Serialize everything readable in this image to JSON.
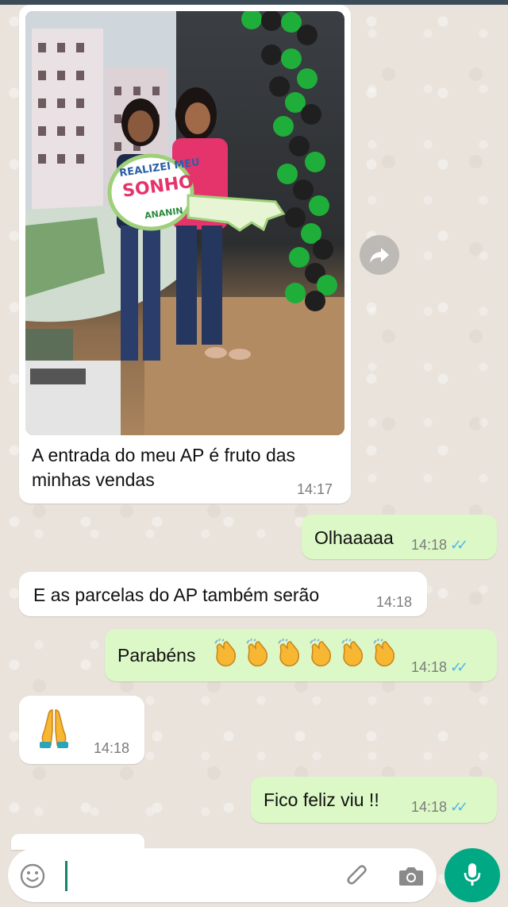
{
  "messages": {
    "m1": {
      "caption": "A entrada do meu AP é fruto das minhas vendas",
      "time": "14:17"
    },
    "m2": {
      "text": "Olhaaaaa",
      "time": "14:18"
    },
    "m3": {
      "text": "E as parcelas do AP também serão",
      "time": "14:18"
    },
    "m4": {
      "text": "Parabéns",
      "time": "14:18",
      "emoji_count": 6
    },
    "m5": {
      "time": "14:18"
    },
    "m6": {
      "text": "Fico feliz  viu !!",
      "time": "14:18"
    }
  },
  "photo": {
    "sign_line1": "REALIZEI MEU",
    "sign_line2": "SONHO!",
    "sign_brand": "ANANIN"
  },
  "colors": {
    "incoming_bubble": "#ffffff",
    "outgoing_bubble": "#dcf8c6",
    "read_ticks": "#4fb6ec",
    "mic_button": "#00a884",
    "balloon_green": "#1fae3a"
  },
  "icons": {
    "forward": "forward-arrow-icon",
    "emoji": "smiley-icon",
    "attach": "paperclip-icon",
    "camera": "camera-icon",
    "mic": "microphone-icon",
    "read": "double-check-icon"
  }
}
